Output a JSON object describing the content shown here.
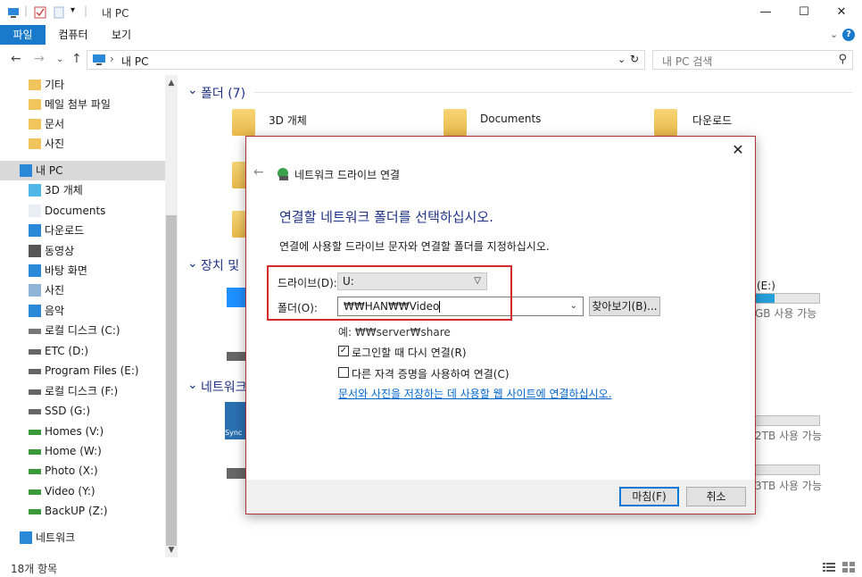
{
  "window": {
    "title": "내 PC",
    "controls": {
      "minimize": "—",
      "maximize": "☐",
      "close": "✕"
    }
  },
  "ribbon": {
    "tabs": [
      {
        "label": "파일",
        "active": true
      },
      {
        "label": "컴퓨터",
        "active": false
      },
      {
        "label": "보기",
        "active": false
      }
    ],
    "collapse": "⌄",
    "help": "?"
  },
  "nav": {
    "back": "←",
    "forward": "→",
    "recent": "⌄",
    "up": "↑",
    "address_path": "내 PC",
    "address_separator": "›",
    "refresh": "↻",
    "search_placeholder": "내 PC 검색"
  },
  "sidebar": {
    "items": [
      {
        "label": "기타",
        "icon": "folder-icon"
      },
      {
        "label": "메일 첨부 파일",
        "icon": "folder-icon"
      },
      {
        "label": "문서",
        "icon": "folder-icon"
      },
      {
        "label": "사진",
        "icon": "folder-icon"
      },
      {
        "label": "내 PC",
        "icon": "pc-icon",
        "selected": true
      },
      {
        "label": "3D 개체",
        "icon": "3d-objects-icon"
      },
      {
        "label": "Documents",
        "icon": "document-icon"
      },
      {
        "label": "다운로드",
        "icon": "download-icon"
      },
      {
        "label": "동영상",
        "icon": "video-icon"
      },
      {
        "label": "바탕 화면",
        "icon": "desktop-icon"
      },
      {
        "label": "사진",
        "icon": "pictures-icon"
      },
      {
        "label": "음악",
        "icon": "music-icon"
      },
      {
        "label": "로컬 디스크 (C:)",
        "icon": "local-disk-icon"
      },
      {
        "label": "ETC (D:)",
        "icon": "drive-icon"
      },
      {
        "label": "Program Files (E:)",
        "icon": "drive-icon"
      },
      {
        "label": "로컬 디스크 (F:)",
        "icon": "drive-icon"
      },
      {
        "label": "SSD (G:)",
        "icon": "drive-icon"
      },
      {
        "label": "Homes (V:)",
        "icon": "network-drive-icon"
      },
      {
        "label": "Home (W:)",
        "icon": "network-drive-icon"
      },
      {
        "label": "Photo (X:)",
        "icon": "network-drive-icon"
      },
      {
        "label": "Video (Y:)",
        "icon": "network-drive-icon"
      },
      {
        "label": "BackUP (Z:)",
        "icon": "network-drive-icon"
      },
      {
        "label": "네트워크",
        "icon": "network-icon"
      }
    ]
  },
  "main": {
    "groups": {
      "folders": "폴더 (7)",
      "devices": "장치 및",
      "network": "네트워크"
    },
    "folder_tiles": [
      "3D 개체",
      "Documents",
      "다운로드"
    ],
    "device_free": [
      "GB 사용 가능",
      "2TB 사용 가능",
      "3TB 사용 가능"
    ],
    "device_fill": [
      0.3,
      0,
      0
    ],
    "drive_letter": "(E:)",
    "synology_label": "Sync"
  },
  "status": {
    "item_count": "18개 항목"
  },
  "dialog": {
    "close": "✕",
    "back": "←",
    "title": "네트워크 드라이브 연결",
    "heading": "연결할 네트워크 폴더를 선택하십시오.",
    "description": "연결에 사용할 드라이브 문자와 연결할 폴더를 지정하십시오.",
    "drive_label": "드라이브(D):",
    "drive_value": "U:",
    "folder_label": "폴더(O):",
    "folder_value": "₩₩HAN₩₩Video",
    "browse_button": "찾아보기(B)...",
    "example": "예: ₩₩server₩share",
    "reconnect_label": "로그인할 때 다시 연결(R)",
    "reconnect_checked": true,
    "other_credentials_label": "다른 자격 증명을 사용하여 연결(C)",
    "other_credentials_checked": false,
    "link_text": "문서와 사진을 저장하는 데 사용할 웹 사이트에 연결하십시오.",
    "finish_button": "마침(F)",
    "cancel_button": "취소"
  },
  "colors": {
    "accent": "#1979ca",
    "heading": "#1e3287",
    "highlight": "#d42a2a",
    "folder": "#f2c55c"
  }
}
